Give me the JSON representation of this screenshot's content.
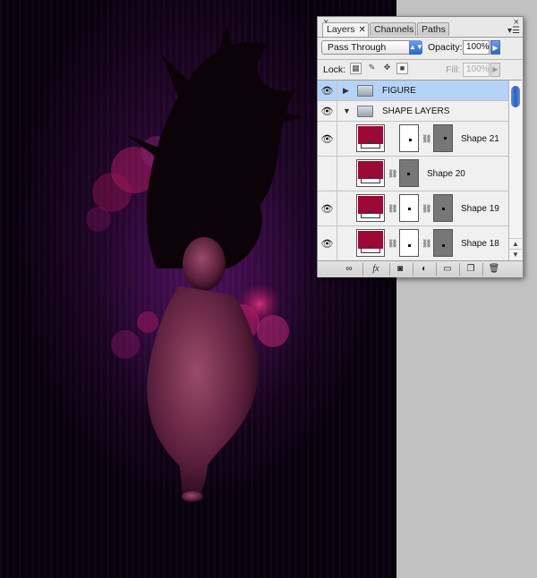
{
  "panel": {
    "tabs": [
      {
        "label": "Layers",
        "close": "✕"
      },
      {
        "label": "Channels"
      },
      {
        "label": "Paths"
      }
    ],
    "blend_mode": "Pass Through",
    "opacity_label": "Opacity:",
    "opacity_value": "100%",
    "lock_label": "Lock:",
    "fill_label": "Fill:",
    "fill_value": "100%"
  },
  "layers": [
    {
      "type": "group",
      "name": "FIGURE",
      "expanded": false,
      "selected": true
    },
    {
      "type": "group",
      "name": "SHAPE LAYERS",
      "expanded": true,
      "selected": false
    },
    {
      "type": "shape",
      "name": "Shape 21",
      "has_vector_mask": true,
      "color": "#9b0a36"
    },
    {
      "type": "shape",
      "name": "Shape 20",
      "has_vector_mask": false,
      "color": "#9b0a36"
    },
    {
      "type": "shape",
      "name": "Shape 19",
      "has_vector_mask": true,
      "color": "#9b0a36"
    },
    {
      "type": "shape",
      "name": "Shape 18",
      "has_vector_mask": true,
      "color": "#9b0a36"
    }
  ],
  "bottom_icons": [
    "link-icon",
    "fx-icon",
    "mask-icon",
    "adjustment-icon",
    "new-group-icon",
    "new-layer-icon",
    "trash-icon"
  ],
  "colors": {
    "selection": "#b5d3f7",
    "canvas_gutter": "#c2c2c2",
    "accent_blue": "#2d64c6"
  }
}
